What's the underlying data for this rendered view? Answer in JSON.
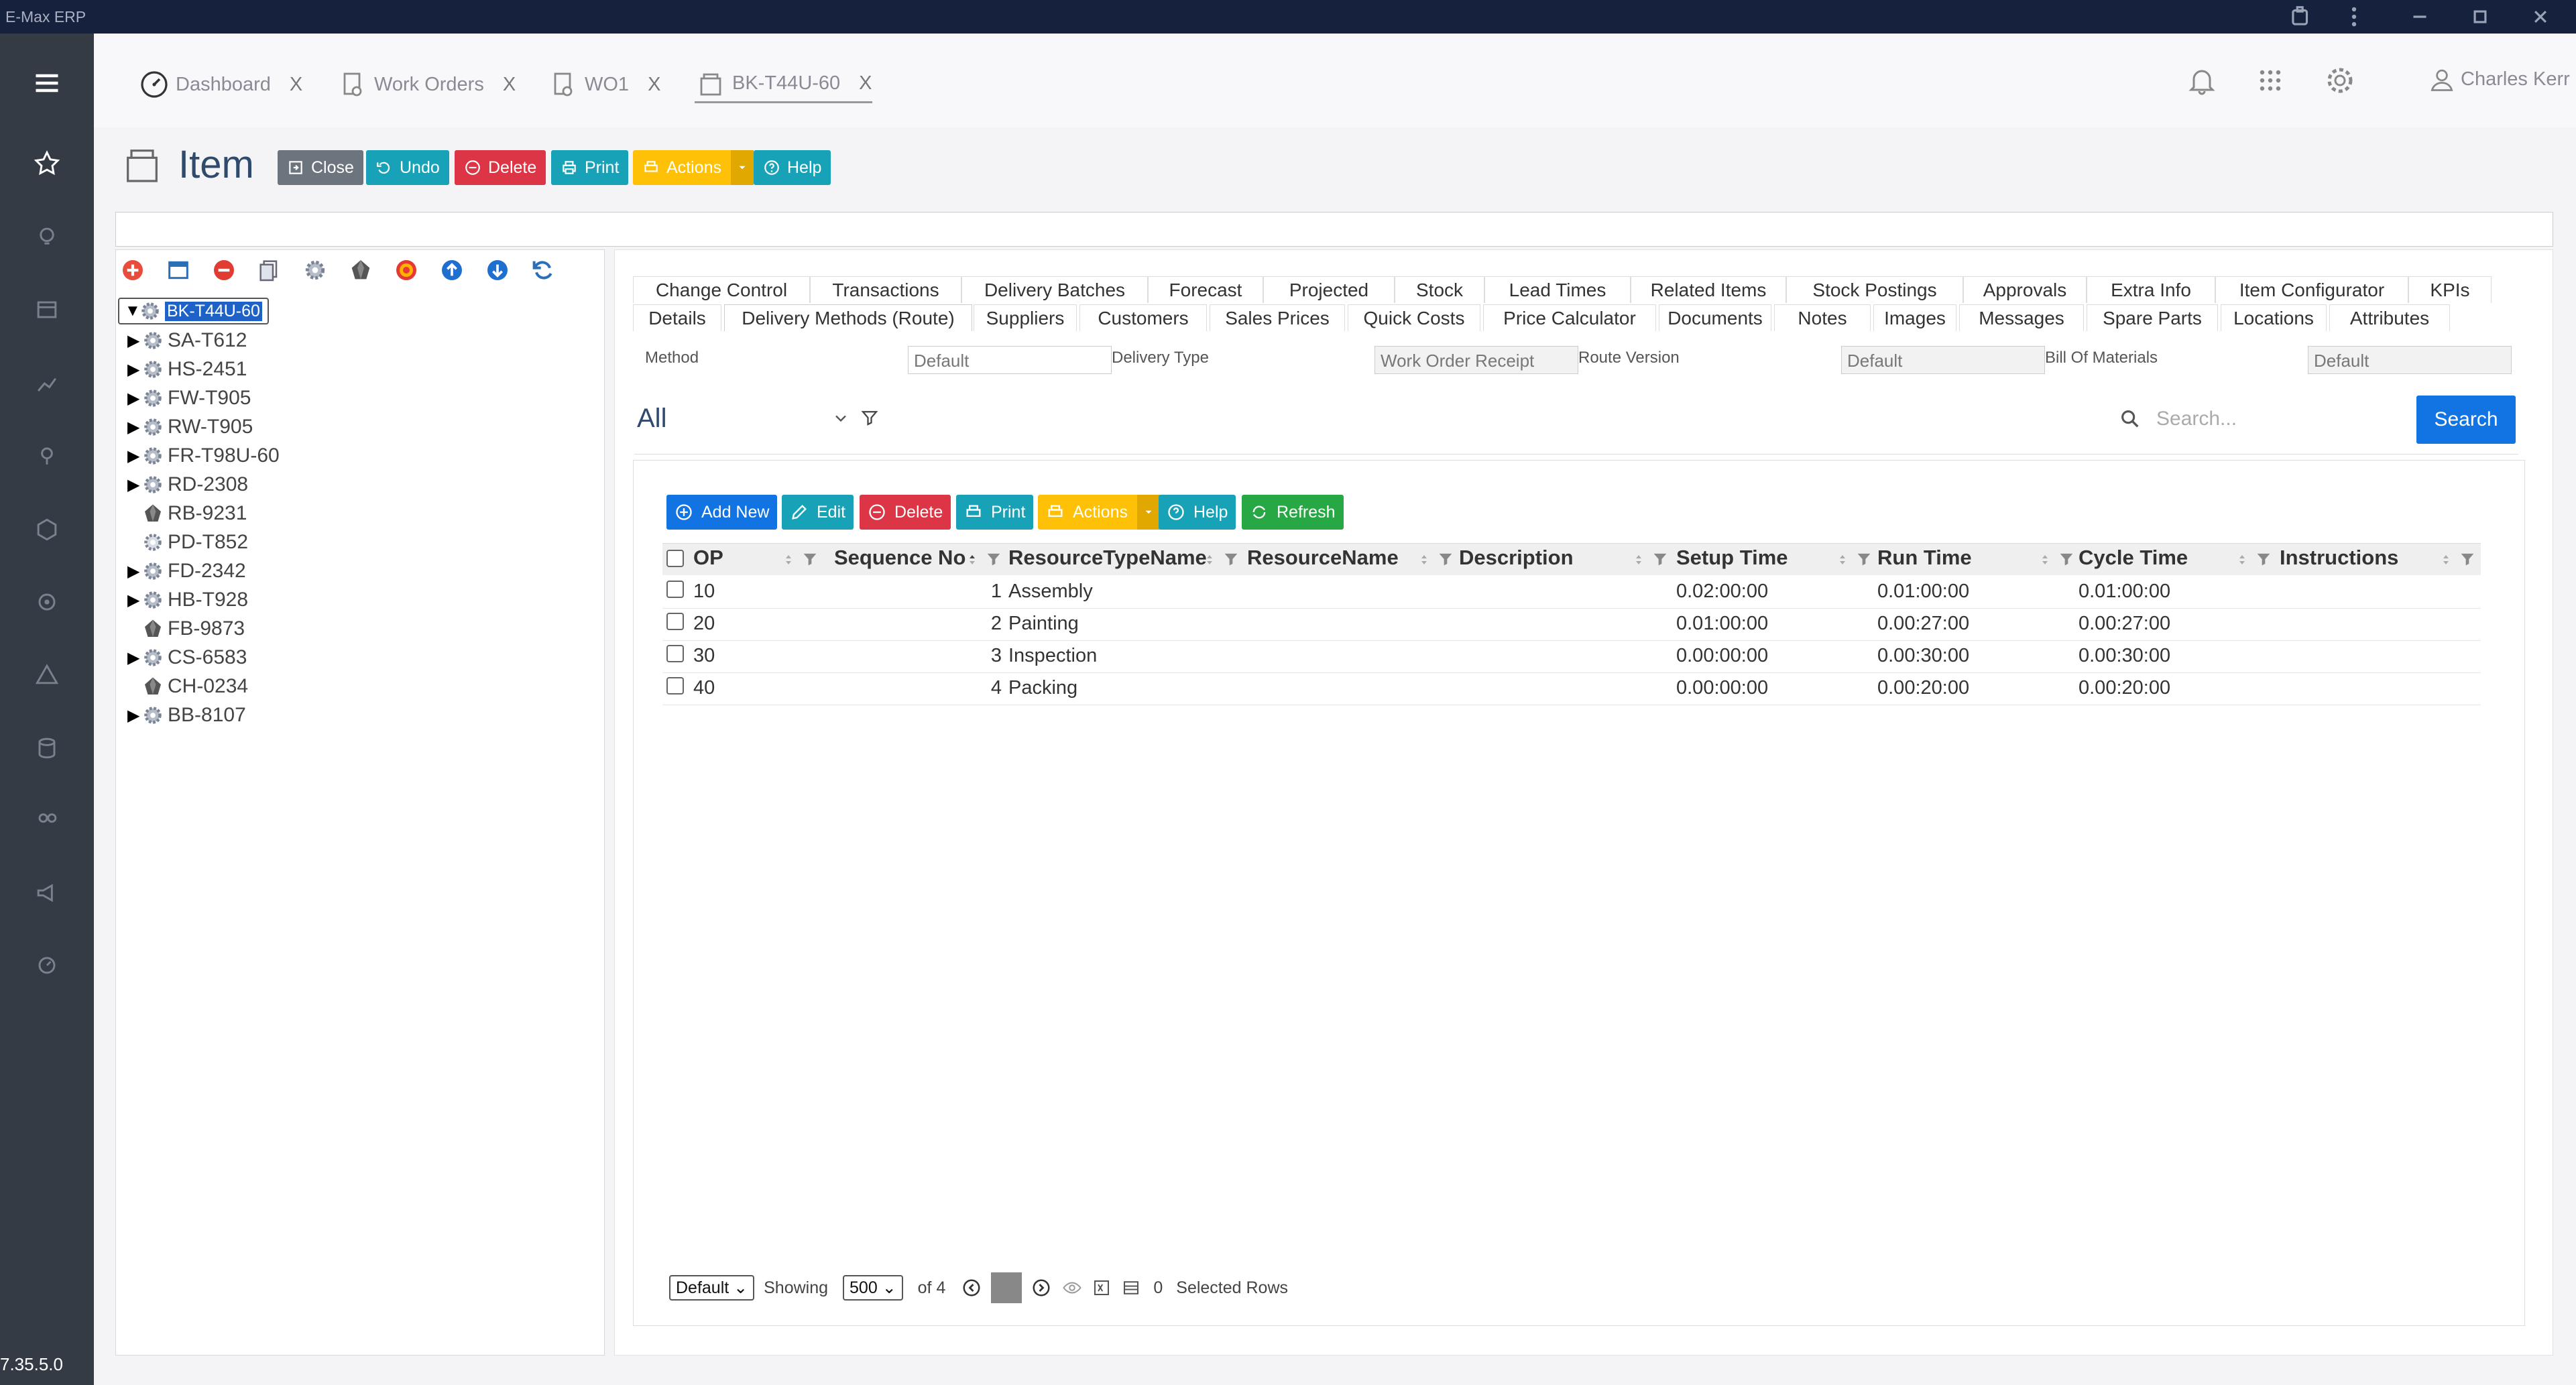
{
  "app": {
    "title": "E-Max ERP",
    "version": "7.35.5.0"
  },
  "tabs": [
    {
      "label": "Dashboard",
      "close": "X"
    },
    {
      "label": "Work Orders",
      "close": "X"
    },
    {
      "label": "WO1",
      "close": "X"
    },
    {
      "label": "BK-T44U-60",
      "close": "X"
    }
  ],
  "user": {
    "name": "Charles Kerr"
  },
  "page": {
    "title": "Item"
  },
  "toolbar": {
    "close": "Close",
    "undo": "Undo",
    "delete": "Delete",
    "print": "Print",
    "actions": "Actions",
    "help": "Help"
  },
  "tree": {
    "root": "BK-T44U-60",
    "children": [
      "SA-T612",
      "HS-2451",
      "FW-T905",
      "RW-T905",
      "FR-T98U-60",
      "RD-2308",
      "RB-9231",
      "PD-T852",
      "FD-2342",
      "HB-T928",
      "FB-9873",
      "CS-6583",
      "CH-0234",
      "BB-8107"
    ]
  },
  "detail_tabs_row1": [
    "Change Control",
    "Transactions",
    "Delivery Batches",
    "Forecast",
    "Projected",
    "Stock",
    "Lead Times",
    "Related Items",
    "Stock Postings",
    "Approvals",
    "Extra Info",
    "Item Configurator",
    "KPIs"
  ],
  "detail_tabs_row2": [
    "Details",
    "Delivery Methods (Route)",
    "Suppliers",
    "Customers",
    "Sales Prices",
    "Quick Costs",
    "Price Calculator",
    "Documents",
    "Notes",
    "Images",
    "Messages",
    "Spare Parts",
    "Locations",
    "Attributes"
  ],
  "fields": {
    "method_label": "Method",
    "method_value": "Default",
    "delivery_type_label": "Delivery Type",
    "delivery_type_value": "Work Order Receipt",
    "route_version_label": "Route Version",
    "route_version_value": "Default",
    "bom_label": "Bill Of Materials",
    "bom_value": "Default"
  },
  "filter": {
    "selected": "All"
  },
  "search": {
    "placeholder": "Search...",
    "button": "Search"
  },
  "grid_toolbar": {
    "add_new": "Add New",
    "edit": "Edit",
    "delete": "Delete",
    "print": "Print",
    "actions": "Actions",
    "help": "Help",
    "refresh": "Refresh"
  },
  "grid": {
    "columns": [
      "OP",
      "Sequence No",
      "ResourceTypeName",
      "ResourceName",
      "Description",
      "Setup Time",
      "Run Time",
      "Cycle Time",
      "Instructions"
    ],
    "rows": [
      {
        "op": "10",
        "seq": "1",
        "type": "Assembly",
        "resource": "",
        "desc": "",
        "setup": "0.02:00:00",
        "run": "0.01:00:00",
        "cycle": "0.01:00:00",
        "instr": ""
      },
      {
        "op": "20",
        "seq": "2",
        "type": "Painting",
        "resource": "",
        "desc": "",
        "setup": "0.01:00:00",
        "run": "0.00:27:00",
        "cycle": "0.00:27:00",
        "instr": ""
      },
      {
        "op": "30",
        "seq": "3",
        "type": "Inspection",
        "resource": "",
        "desc": "",
        "setup": "0.00:00:00",
        "run": "0.00:30:00",
        "cycle": "0.00:30:00",
        "instr": ""
      },
      {
        "op": "40",
        "seq": "4",
        "type": "Packing",
        "resource": "",
        "desc": "",
        "setup": "0.00:00:00",
        "run": "0.00:20:00",
        "cycle": "0.00:20:00",
        "instr": ""
      }
    ]
  },
  "pager": {
    "view": "Default",
    "showing_label": "Showing",
    "page_size": "500",
    "of_label": "of 4",
    "selected_count": "0",
    "selected_label": "Selected Rows"
  },
  "colors": {
    "titlebar": "#16213d",
    "sidenav": "#353b45",
    "accent_blue": "#1274e3",
    "tree_select": "#1f62c7",
    "btn_gray": "#6c757d",
    "btn_teal": "#17a2b8",
    "btn_red": "#dc3545",
    "btn_yellow": "#ffc107",
    "btn_green": "#28a745"
  }
}
